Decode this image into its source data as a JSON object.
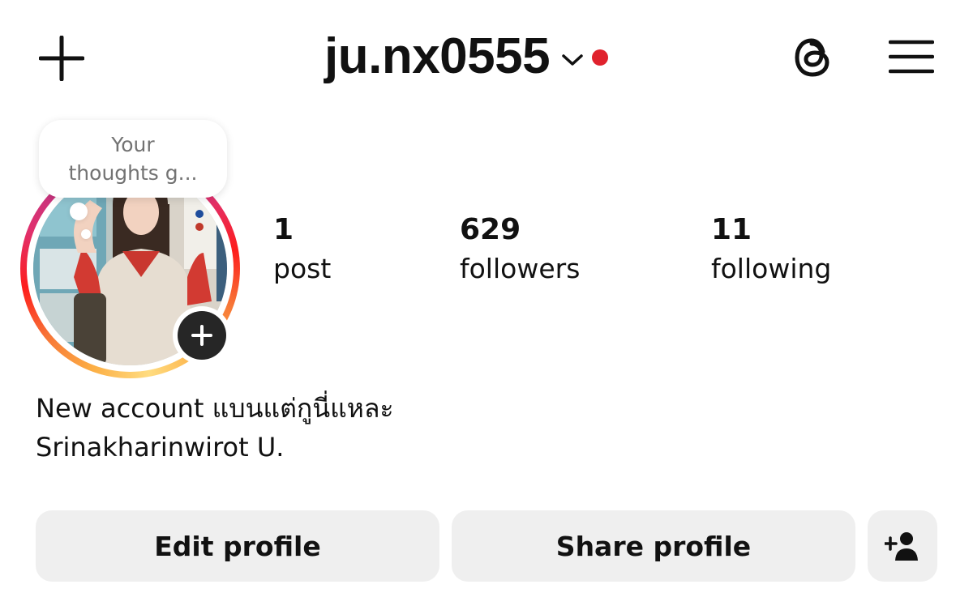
{
  "header": {
    "username": "ju.nx0555",
    "notification_color": "#e0222d",
    "icons": [
      "plus-icon",
      "chevron-down-icon",
      "threads-icon",
      "menu-icon"
    ]
  },
  "note": {
    "text": "Your\nthoughts g..."
  },
  "avatar": {
    "ring_colors": [
      "#fcaf45",
      "#fd1d1d",
      "#c13584",
      "#833ab4"
    ]
  },
  "stats": [
    {
      "value": "1",
      "label": "post"
    },
    {
      "value": "629",
      "label": "followers"
    },
    {
      "value": "11",
      "label": "following"
    }
  ],
  "bio": {
    "line1": "New account แบนแต่กูนี่แหละ",
    "line2": "Srinakharinwirot U."
  },
  "buttons": {
    "edit": "Edit profile",
    "share": "Share profile",
    "discover_icon": "add-person-icon"
  }
}
